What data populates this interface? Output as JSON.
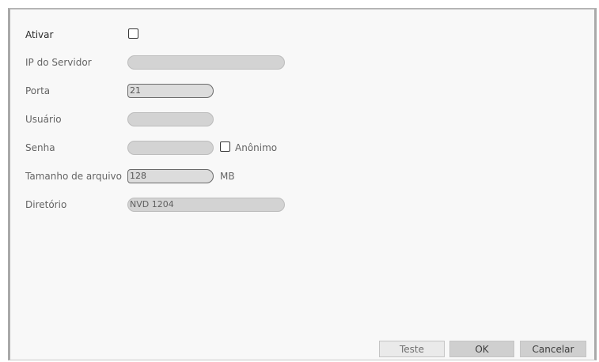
{
  "form": {
    "enable": {
      "label": "Ativar",
      "checked": false
    },
    "server_ip": {
      "label": "IP do Servidor",
      "value": ""
    },
    "port": {
      "label": "Porta",
      "value": "21"
    },
    "username": {
      "label": "Usuário",
      "value": ""
    },
    "password": {
      "label": "Senha",
      "value": ""
    },
    "anonymous": {
      "label": "Anônimo",
      "checked": false
    },
    "file_size": {
      "label": "Tamanho de arquivo",
      "value": "128",
      "unit": "MB"
    },
    "directory": {
      "label": "Diretório",
      "value": "NVD 1204"
    }
  },
  "buttons": {
    "test": "Teste",
    "ok": "OK",
    "cancel": "Cancelar"
  }
}
